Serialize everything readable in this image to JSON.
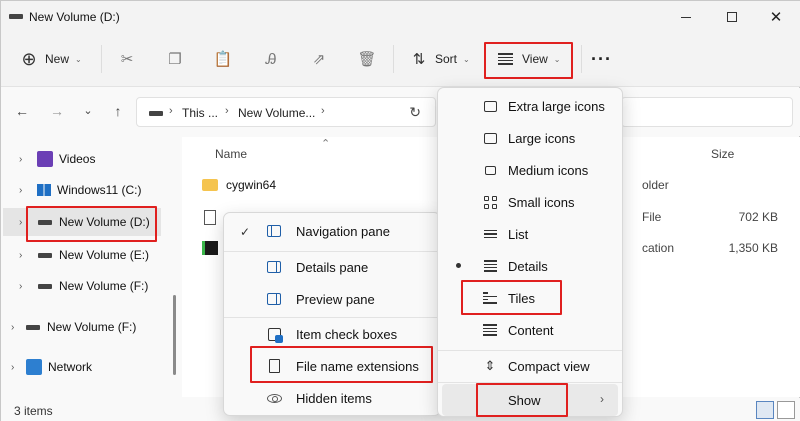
{
  "window": {
    "title": "New Volume (D:)",
    "minimize_label": "",
    "close_glyph": "✕"
  },
  "toolbar": {
    "new_label": "New",
    "sort_label": "Sort",
    "view_label": "View",
    "more_glyph": "···",
    "icons": [
      "cut-icon",
      "copy-icon",
      "paste-icon",
      "rename-icon",
      "share-icon",
      "delete-icon"
    ]
  },
  "address": {
    "back_glyph": "←",
    "forward_glyph": "→",
    "recent_glyph": "⌄",
    "up_glyph": "↑",
    "crumb_1": "This ...",
    "crumb_2": "New Volume...",
    "refresh_glyph": "↻"
  },
  "nav_pane": {
    "items": [
      {
        "label": "Videos"
      },
      {
        "label": "Windows11 (C:)"
      },
      {
        "label": "New Volume (D:)"
      },
      {
        "label": "New Volume (E:)"
      },
      {
        "label": "New Volume (F:)"
      },
      {
        "label": "New Volume (F:)"
      },
      {
        "label": "Network"
      }
    ]
  },
  "file_list": {
    "headers": {
      "name": "Name",
      "size": "Size"
    },
    "rows": [
      {
        "name": "cygwin64",
        "type": "older",
        "size": ""
      },
      {
        "name": "",
        "type": "File",
        "size": "702 KB"
      },
      {
        "name": "",
        "type": "cation",
        "size": "1,350 KB"
      }
    ]
  },
  "status": {
    "items_text": "3 items"
  },
  "view_menu": {
    "items": [
      {
        "label": "Extra large icons"
      },
      {
        "label": "Large icons"
      },
      {
        "label": "Medium icons"
      },
      {
        "label": "Small icons"
      },
      {
        "label": "List"
      },
      {
        "label": "Details"
      },
      {
        "label": "Tiles"
      },
      {
        "label": "Content"
      },
      {
        "label": "Compact view"
      },
      {
        "label": "Show"
      }
    ],
    "submenu_arrow": "›"
  },
  "show_menu": {
    "items": [
      {
        "label": "Navigation pane"
      },
      {
        "label": "Details pane"
      },
      {
        "label": "Preview pane"
      },
      {
        "label": "Item check boxes"
      },
      {
        "label": "File name extensions"
      },
      {
        "label": "Hidden items"
      }
    ],
    "check_glyph": "✓"
  },
  "colors": {
    "highlight": "#e0201f",
    "accent": "#1f6fc4"
  }
}
